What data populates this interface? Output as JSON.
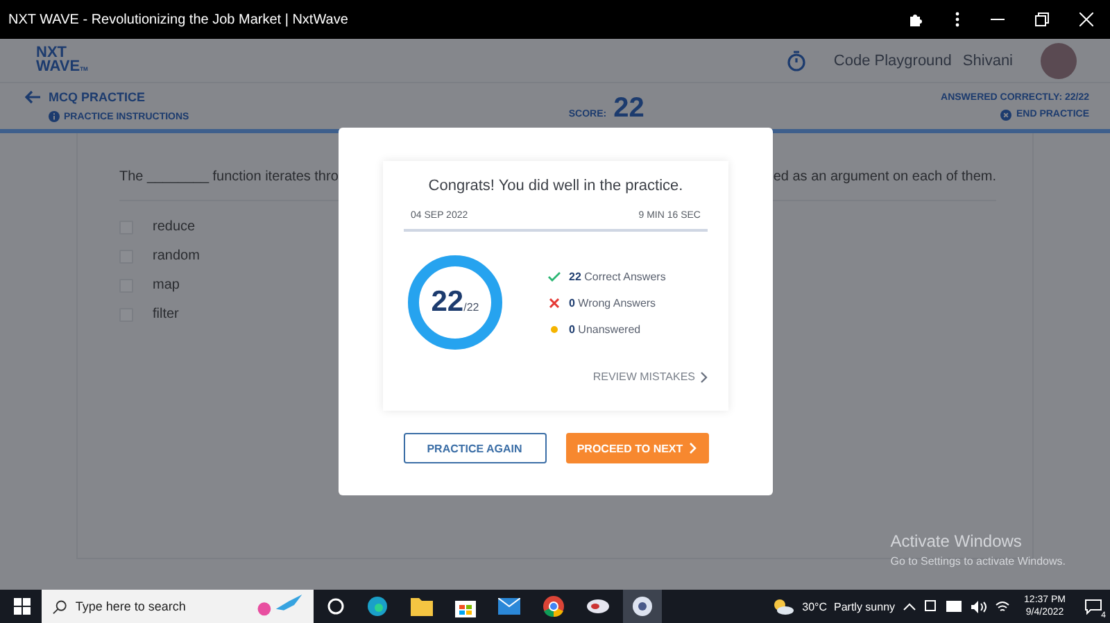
{
  "window": {
    "title": "NXT WAVE - Revolutionizing the Job Market | NxtWave"
  },
  "header": {
    "logo_top": "NXT",
    "logo_bottom": "WAVE",
    "logo_mark": "TM",
    "links": [
      "Code Playground"
    ],
    "user": "Shivani"
  },
  "subheader": {
    "back_title": "MCQ PRACTICE",
    "instructions": "PRACTICE INSTRUCTIONS",
    "score_label": "SCORE:",
    "score": "22",
    "answered": "ANSWERED CORRECTLY: 22/22",
    "end": "END PRACTICE"
  },
  "question": {
    "text_start": "The ________ function iterates thro",
    "text_end": "ed as an argument on each of them.",
    "options": [
      {
        "label": "reduce",
        "checked": false
      },
      {
        "label": "random",
        "checked": false
      },
      {
        "label": "map",
        "checked": false
      },
      {
        "label": "filter",
        "checked": false
      }
    ]
  },
  "modal": {
    "title": "Congrats! You did well in the practice.",
    "date": "04 SEP 2022",
    "duration": "9 MIN 16 SEC",
    "score": "22",
    "total": "/22",
    "level": 1,
    "stats": [
      {
        "kind": "correct",
        "count": "22",
        "label": "Correct Answers"
      },
      {
        "kind": "wrong",
        "count": "0",
        "label": "Wrong Answers"
      },
      {
        "kind": "unanswered",
        "count": "0",
        "label": "Unanswered"
      }
    ],
    "review": "REVIEW MISTAKES",
    "buttons": [
      {
        "kind": "outline",
        "label": "PRACTICE AGAIN"
      },
      {
        "kind": "primary",
        "label": "PROCEED TO NEXT"
      }
    ]
  },
  "activation": {
    "title": "Activate Windows",
    "hint": "Go to Settings to activate Windows."
  },
  "taskbar": {
    "search_placeholder": "Type here to search",
    "temperature": "30°C",
    "weather": "Partly sunny",
    "time": "12:37 PM",
    "date": "9/4/2022",
    "notifications": "4"
  }
}
